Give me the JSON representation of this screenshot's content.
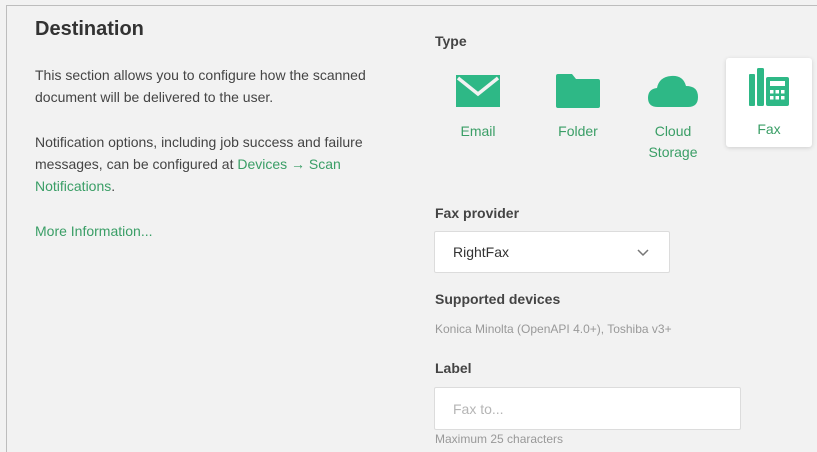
{
  "section": {
    "title": "Destination",
    "description1": "This section allows you to configure how the scanned document will be delivered to the user.",
    "description2_prefix": "Notification options, including job success and failure messages, can be configured at ",
    "description2_link": "Devices → Scan Notifications",
    "description2_suffix": ".",
    "more_info": "More Information..."
  },
  "type": {
    "label": "Type",
    "options": [
      {
        "label": "Email",
        "icon": "envelope-icon",
        "selected": false
      },
      {
        "label": "Folder",
        "icon": "folder-icon",
        "selected": false
      },
      {
        "label": "Cloud Storage",
        "icon": "cloud-icon",
        "selected": false
      },
      {
        "label": "Fax",
        "icon": "fax-icon",
        "selected": true
      }
    ]
  },
  "fax_provider": {
    "label": "Fax provider",
    "value": "RightFax"
  },
  "supported_devices": {
    "label": "Supported devices",
    "value": "Konica Minolta (OpenAPI 4.0+), Toshiba v3+"
  },
  "label_field": {
    "label": "Label",
    "placeholder": "Fax to...",
    "value": "",
    "hint": "Maximum 25 characters"
  },
  "colors": {
    "accent": "#3a9e66",
    "icon": "#2eb886"
  }
}
